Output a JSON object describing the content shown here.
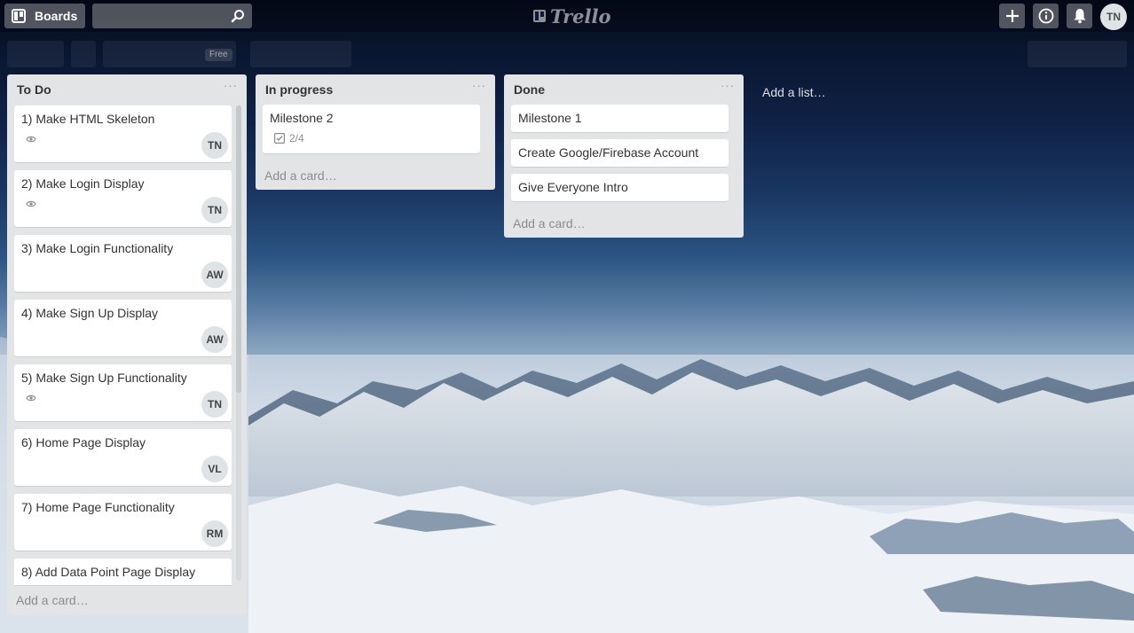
{
  "header": {
    "boards_label": "Boards",
    "search_placeholder": "",
    "logo_text": "Trello",
    "user_initials": "TN"
  },
  "board": {
    "badge": "Free"
  },
  "lists": [
    {
      "title": "To Do",
      "menu": "···",
      "add_card": "Add a card…",
      "cards": [
        {
          "title": "1) Make HTML Skeleton",
          "watched": true,
          "member": "TN"
        },
        {
          "title": "2) Make Login Display",
          "watched": true,
          "member": "TN"
        },
        {
          "title": "3) Make Login Functionality",
          "watched": false,
          "member": "AW"
        },
        {
          "title": "4) Make Sign Up Display",
          "watched": false,
          "member": "AW"
        },
        {
          "title": "5) Make Sign Up Functionality",
          "watched": true,
          "member": "TN"
        },
        {
          "title": "6) Home Page Display",
          "watched": false,
          "member": "VL"
        },
        {
          "title": "7) Home Page Functionality",
          "watched": false,
          "member": "RM"
        },
        {
          "title": "8) Add Data Point Page Display",
          "watched": false,
          "member": ""
        }
      ]
    },
    {
      "title": "In progress",
      "menu": "···",
      "add_card": "Add a card…",
      "cards": [
        {
          "title": "Milestone 2",
          "checklist": "2/4"
        }
      ]
    },
    {
      "title": "Done",
      "menu": "···",
      "add_card": "Add a card…",
      "cards": [
        {
          "title": "Milestone 1"
        },
        {
          "title": "Create Google/Firebase Account"
        },
        {
          "title": "Give Everyone Intro"
        }
      ]
    }
  ],
  "add_list": "Add a list…",
  "icons": {
    "boards": "boards-icon",
    "search": "search-icon",
    "add": "plus-icon",
    "info": "info-icon",
    "notifications": "bell-icon",
    "watch": "eye-icon",
    "checklist": "checklist-icon"
  }
}
